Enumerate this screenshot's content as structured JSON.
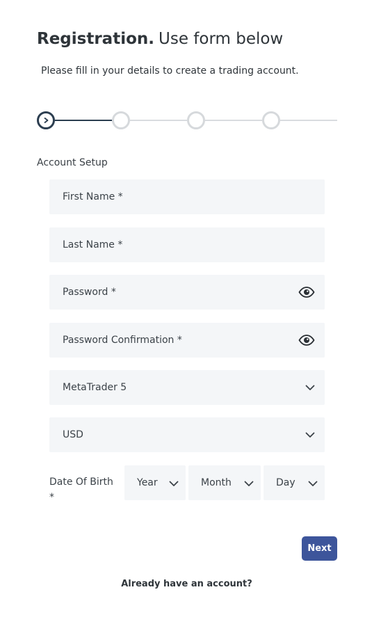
{
  "header": {
    "title_bold": "Registration.",
    "title_rest": "Use form below",
    "subtitle": "Please fill in your details to create a trading account."
  },
  "stepper": {
    "current_step": 1,
    "total_steps": 4
  },
  "section": {
    "label": "Account Setup"
  },
  "fields": {
    "first_name": "First Name  *",
    "last_name": "Last Name  *",
    "password": "Password  *",
    "password_confirmation": "Password Confirmation  *",
    "platform": "MetaTrader 5",
    "currency": "USD"
  },
  "dob": {
    "label": "Date Of Birth *",
    "year": "Year",
    "month": "Month",
    "day": "Day"
  },
  "actions": {
    "next_label": "Next",
    "login_link": "Already have an account?"
  },
  "colors": {
    "primary": "#3d559b",
    "stepper_active": "#2c3e50",
    "field_bg": "#f4f6f8"
  }
}
